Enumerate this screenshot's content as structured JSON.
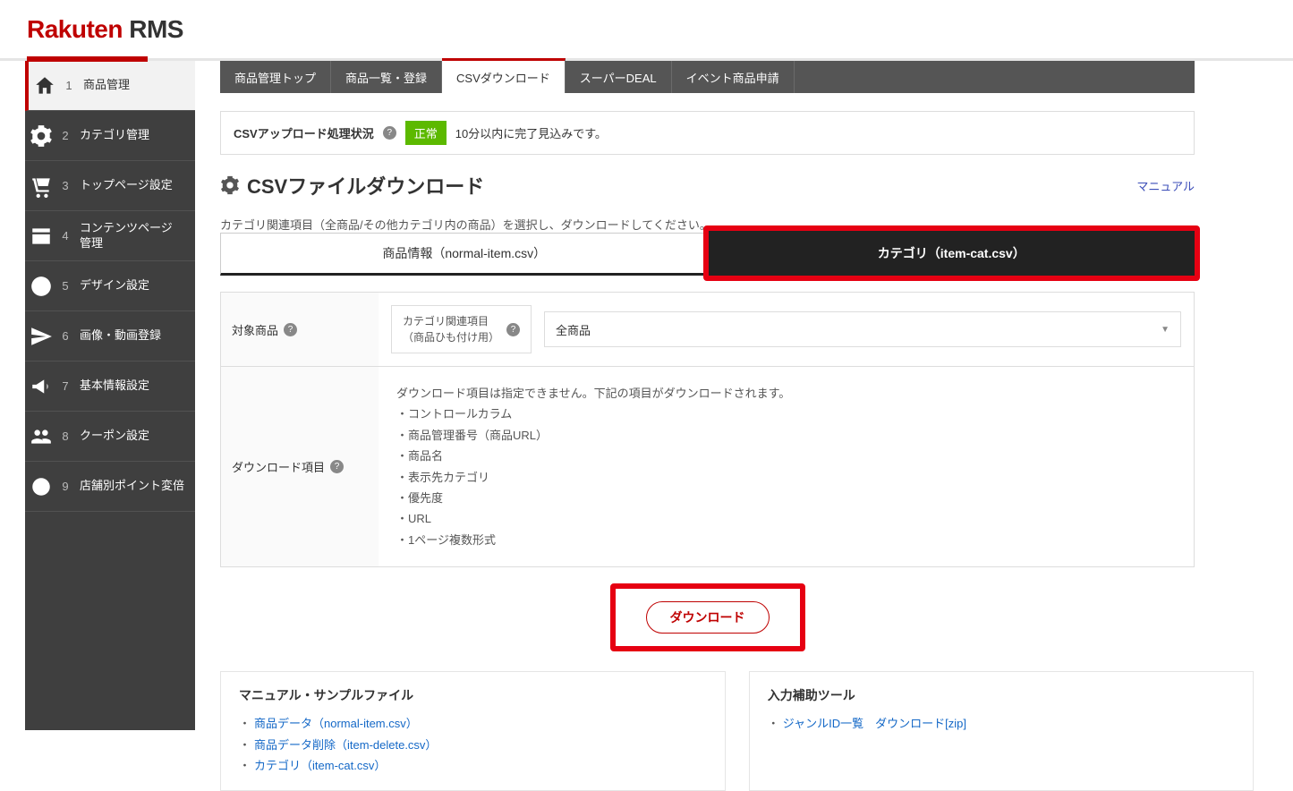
{
  "brand": {
    "part1": "Rakuten",
    "part2": " RMS"
  },
  "sidebar": [
    {
      "num": "1",
      "label": "商品管理"
    },
    {
      "num": "2",
      "label": "カテゴリ管理"
    },
    {
      "num": "3",
      "label": "トップページ設定"
    },
    {
      "num": "4",
      "label": "コンテンツページ\n管理"
    },
    {
      "num": "5",
      "label": "デザイン設定"
    },
    {
      "num": "6",
      "label": "画像・動画登録"
    },
    {
      "num": "7",
      "label": "基本情報設定"
    },
    {
      "num": "8",
      "label": "クーポン設定"
    },
    {
      "num": "9",
      "label": "店舗別ポイント変倍"
    }
  ],
  "tabs": [
    {
      "label": "商品管理トップ"
    },
    {
      "label": "商品一覧・登録"
    },
    {
      "label": "CSVダウンロード"
    },
    {
      "label": "スーパーDEAL"
    },
    {
      "label": "イベント商品申請"
    }
  ],
  "status": {
    "label": "CSVアップロード処理状況",
    "badge": "正常",
    "text": "10分以内に完了見込みです。"
  },
  "pageTitle": "CSVファイルダウンロード",
  "manualLink": "マニュアル",
  "instruction": "カテゴリ関連項目（全商品/その他カテゴリ内の商品）を選択し、ダウンロードしてください。",
  "fileTabs": {
    "normal": "商品情報（normal-item.csv）",
    "category": "カテゴリ（item-cat.csv）"
  },
  "panel": {
    "targetLabel": "対象商品",
    "subbox": "カテゴリ関連項目\n（商品ひも付け用）",
    "selectValue": "全商品",
    "dlLabel": "ダウンロード項目",
    "dlIntro": "ダウンロード項目は指定できません。下記の項目がダウンロードされます。",
    "dlItems": [
      "コントロールカラム",
      "商品管理番号（商品URL）",
      "商品名",
      "表示先カテゴリ",
      "優先度",
      "URL",
      "1ページ複数形式"
    ]
  },
  "downloadBtn": "ダウンロード",
  "cards": {
    "left": {
      "title": "マニュアル・サンプルファイル",
      "links": [
        "商品データ（normal-item.csv）",
        "商品データ削除（item-delete.csv）",
        "カテゴリ（item-cat.csv）"
      ]
    },
    "right": {
      "title": "入力補助ツール",
      "links": [
        "ジャンルID一覧　ダウンロード[zip]"
      ]
    }
  }
}
